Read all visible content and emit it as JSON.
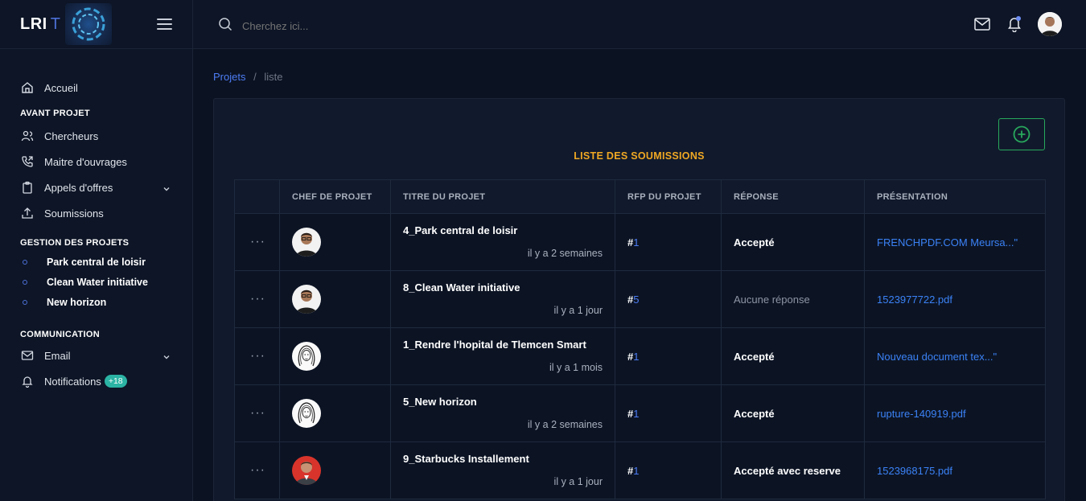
{
  "brand": {
    "name": "LRI",
    "suffix": "T",
    "logo_text": "LRIT"
  },
  "search": {
    "placeholder": "Cherchez ici..."
  },
  "sidebar": {
    "home": "Accueil",
    "sections": [
      {
        "title": "AVANT PROJET",
        "items": [
          "Chercheurs",
          "Maitre d'ouvrages",
          "Appels d'offres",
          "Soumissions"
        ]
      },
      {
        "title": "GESTION DES PROJETS",
        "items": [
          "Park central de loisir",
          "Clean Water initiative",
          "New horizon"
        ]
      },
      {
        "title": "COMMUNICATION",
        "items": [
          "Email",
          "Notifications"
        ]
      }
    ],
    "notif_badge": "+18"
  },
  "breadcrumb": {
    "parent": "Projets",
    "sep": "/",
    "current": "liste"
  },
  "card": {
    "title": "LISTE DES SOUMISSIONS"
  },
  "table": {
    "headers": [
      "",
      "CHEF DE PROJET",
      "TITRE DU PROJET",
      "RFP DU PROJET",
      "RÉPONSE",
      "PRÉSENTATION"
    ],
    "rows": [
      {
        "dots": "···",
        "title": "4_Park central de loisir",
        "ago": "il y a 2 semaines",
        "rfp_hash": "#",
        "rfp_num": "1",
        "response": "Accepté",
        "presentation": "FRENCHPDF.COM Meursa...\"",
        "avatar": "man-glasses"
      },
      {
        "dots": "···",
        "title": "8_Clean Water initiative",
        "ago": "il y a 1 jour",
        "rfp_hash": "#",
        "rfp_num": "5",
        "response": "Aucune réponse",
        "presentation": "1523977722.pdf",
        "avatar": "man-glasses"
      },
      {
        "dots": "···",
        "title": "1_Rendre l'hopital de Tlemcen Smart",
        "ago": "il y a 1 mois",
        "rfp_hash": "#",
        "rfp_num": "1",
        "response": "Accepté",
        "presentation": "Nouveau document tex...\"",
        "avatar": "sketch-woman"
      },
      {
        "dots": "···",
        "title": "5_New horizon",
        "ago": "il y a 2 semaines",
        "rfp_hash": "#",
        "rfp_num": "1",
        "response": "Accepté",
        "presentation": "rupture-140919.pdf",
        "avatar": "sketch-woman"
      },
      {
        "dots": "···",
        "title": "9_Starbucks Installement",
        "ago": "il y a 1 jour",
        "rfp_hash": "#",
        "rfp_num": "1",
        "response": "Accepté avec reserve",
        "presentation": "1523968175.pdf",
        "avatar": "man-red"
      }
    ]
  },
  "colors": {
    "accent": "#4d7df5",
    "title": "#f0a823",
    "add": "#28a85c",
    "badge": "#2bb3a4"
  }
}
